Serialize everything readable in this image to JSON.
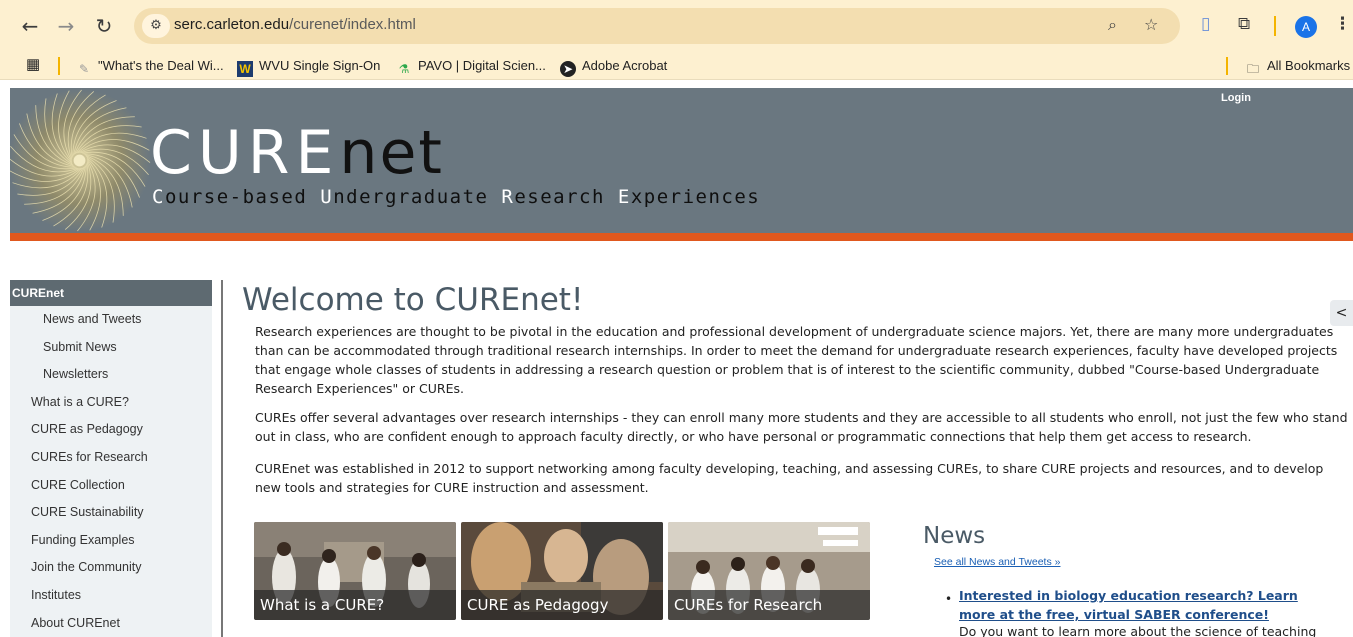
{
  "browser": {
    "url_host": "serc.carleton.edu",
    "url_path": "/curenet/index.html",
    "avatar_letter": "A",
    "bookmarks": [
      {
        "label": "\"What's the Deal Wi...",
        "icon": "pen-nib-icon"
      },
      {
        "label": "WVU Single Sign-On",
        "icon": "wvu-logo-icon"
      },
      {
        "label": "PAVO | Digital Scien...",
        "icon": "flask-icon"
      },
      {
        "label": "Adobe Acrobat",
        "icon": "acrobat-icon"
      }
    ],
    "all_bookmarks": "All Bookmarks"
  },
  "header": {
    "brand_main": "CURE",
    "brand_net": "net",
    "sub": {
      "c": "C",
      "ourse": "ourse-based ",
      "u": "U",
      "ndergraduate": "ndergraduate ",
      "r": "R",
      "esearch": "esearch ",
      "e": "E",
      "xperiences": "xperiences"
    },
    "login": "Login",
    "colors": {
      "banner": "#6a7780",
      "accent": "#e0581e"
    }
  },
  "sidebar": {
    "heading": "CUREnet",
    "items": [
      {
        "label": "News and Tweets",
        "level": "sub"
      },
      {
        "label": "Submit News",
        "level": "sub"
      },
      {
        "label": "Newsletters",
        "level": "sub"
      },
      {
        "label": "What is a CURE?",
        "level": "top"
      },
      {
        "label": "CURE as Pedagogy",
        "level": "top"
      },
      {
        "label": "CUREs for Research",
        "level": "top"
      },
      {
        "label": "CURE Collection",
        "level": "top"
      },
      {
        "label": "CURE Sustainability",
        "level": "top"
      },
      {
        "label": "Funding Examples",
        "level": "top"
      },
      {
        "label": "Join the Community",
        "level": "top"
      },
      {
        "label": "Institutes",
        "level": "top"
      },
      {
        "label": "About CUREnet",
        "level": "top"
      }
    ]
  },
  "main": {
    "title": "Welcome to CUREnet!",
    "paragraphs": [
      "Research experiences are thought to be pivotal in the education and professional development of undergraduate science majors. Yet, there are many more undergraduates than can be accommodated through traditional research internships. In order to meet the demand for undergraduate research experiences, faculty have developed projects that engage whole classes of students in addressing a research question or problem that is of interest to the scientific community, dubbed \"Course-based Undergraduate Research Experiences\" or CUREs.",
      "CUREs offer several advantages over research internships - they can enroll many more students and they are accessible to all students who enroll, not just the few who stand out in class, who are confident enough to approach faculty directly, or who have personal or programmatic connections that help them get access to research.",
      "CUREnet was established in 2012 to support networking among faculty developing, teaching, and assessing CUREs, to share CURE projects and resources, and to develop new tools and strategies for CURE instruction and assessment."
    ],
    "tiles": [
      {
        "caption": "What is a CURE?"
      },
      {
        "caption": "CURE as Pedagogy"
      },
      {
        "caption": "CUREs for Research"
      }
    ]
  },
  "news": {
    "heading": "News",
    "see_all": "See all News and Tweets »",
    "items": [
      {
        "title": "Interested in biology education research? Learn more at the free, virtual SABER conference!",
        "body": "Do you want to learn more about the science of teaching"
      }
    ]
  }
}
